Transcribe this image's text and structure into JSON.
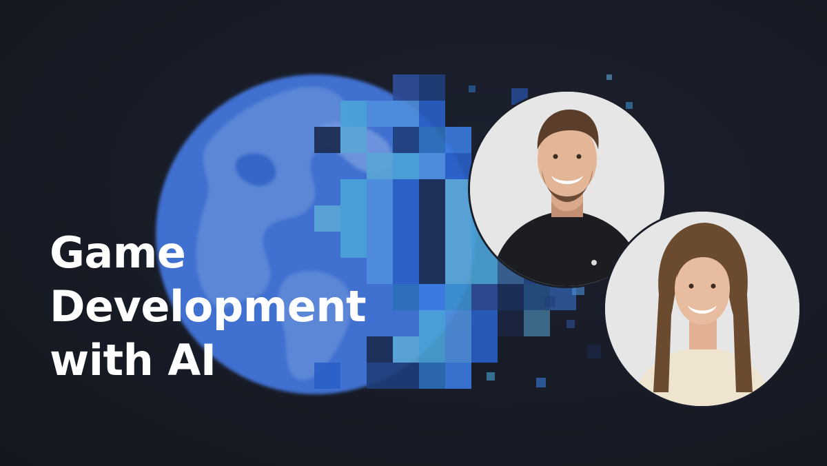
{
  "title_lines": [
    "Game",
    "Development",
    "with AI"
  ],
  "colors": {
    "background": "#181c27",
    "globe_blue": "#3f73d4",
    "globe_land": "#5a87d8",
    "title_text": "#ffffff",
    "portrait_bg": "#e6e6e6"
  },
  "icons": [
    "pixelated-globe-icon",
    "speaker-portrait-man",
    "speaker-portrait-woman"
  ]
}
